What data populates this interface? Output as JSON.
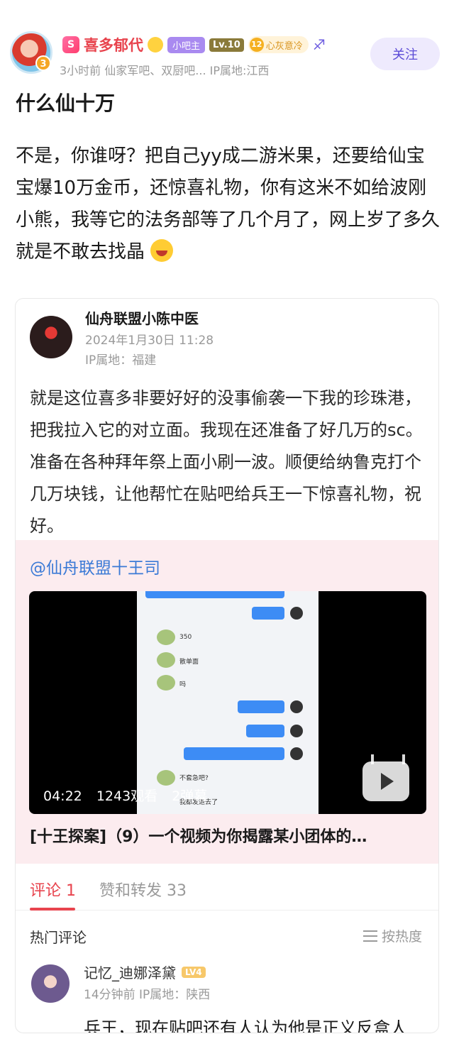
{
  "post": {
    "author": {
      "level_badge": "S",
      "name": "喜多郁代",
      "avatar_badge": "3",
      "owner_tag": "小吧主",
      "level_tag": "Lv.10",
      "mood_level": "12",
      "mood_text": "心灰意冷",
      "zodiac_icon": "♐"
    },
    "meta": "3小时前   仙家军吧、双厨吧...  IP属地:江西",
    "follow_label": "关注",
    "title": "什么仙十万",
    "body": "不是，你谁呀？把自己yy成二游米果，还要给仙宝宝爆10万金币，还惊喜礼物，你有这米不如给波刚小熊，我等它的法务部等了几个月了，网上岁了多久就是不敢去找晶"
  },
  "quoted": {
    "author_name": "仙舟联盟小陈中医",
    "date": "2024年1月30日 11:28",
    "ip": "IP属地：福建",
    "body": "就是这位喜多非要好好的没事偷袭一下我的珍珠港，把我拉入它的对立面。我现在还准备了好几万的sc。准备在各种拜年祭上面小刷一波。顺便给纳鲁克打个几万块钱，让他帮忙在贴吧给兵王一下惊喜礼物，祝好。",
    "mention": "@仙舟联盟十王司",
    "video": {
      "duration": "04:22",
      "views": "1243观看",
      "danmaku": "2弹幕",
      "chat_350": "350",
      "chat_2": "散单面",
      "chat_3": "吗",
      "chat_4": "不套急吧?",
      "chat_5": "我都发退去了",
      "title": "[十王探案]（9）一个视频为你揭露某小团体的…"
    },
    "tabs": {
      "comments": "评论 1",
      "likes": "赞和转发 33"
    },
    "hot_title": "热门评论",
    "sort_label": "按热度",
    "comment": {
      "name": "记忆_迪娜泽黛",
      "level": "LV4",
      "meta": "14分钟前  IP属地：陕西",
      "body": "兵王，现在贴吧还有人认为他是正义反盒人"
    }
  },
  "colors": {
    "accent": "#e8444e",
    "follow_bg": "#eeeafd",
    "link": "#3b7ad6"
  }
}
